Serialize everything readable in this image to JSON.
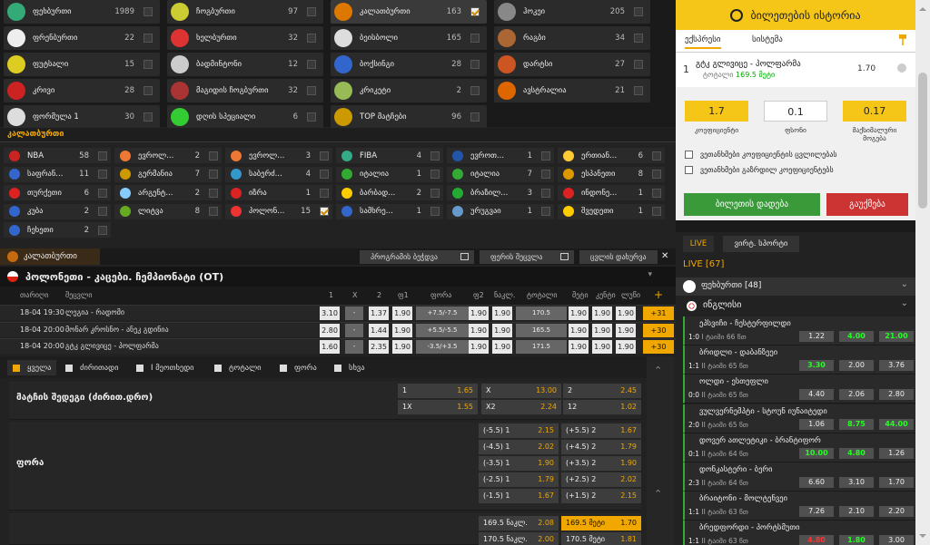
{
  "sports": [
    {
      "name": "ფეხბურთი",
      "count": "1989",
      "color": "#3a7",
      "checked": false
    },
    {
      "name": "ჩოგბურთი",
      "count": "97",
      "color": "#cc3",
      "checked": false
    },
    {
      "name": "კალათბურთი",
      "count": "163",
      "color": "#d70",
      "checked": true,
      "selected": true
    },
    {
      "name": "ჰოკეი",
      "count": "205",
      "color": "#888",
      "checked": false
    },
    {
      "name": "ფრენბურთი",
      "count": "22",
      "color": "#eee",
      "checked": false
    },
    {
      "name": "ხელბურთი",
      "count": "32",
      "color": "#d33",
      "checked": false
    },
    {
      "name": "ბეისბოლი",
      "count": "165",
      "color": "#ddd",
      "checked": false
    },
    {
      "name": "რაგბი",
      "count": "34",
      "color": "#a63",
      "checked": false
    },
    {
      "name": "ფუტსალი",
      "count": "15",
      "color": "#dc2",
      "checked": false
    },
    {
      "name": "ბადმინტონი",
      "count": "12",
      "color": "#ccc",
      "checked": false
    },
    {
      "name": "ბოქსინგი",
      "count": "28",
      "color": "#36c",
      "checked": false
    },
    {
      "name": "დარტსი",
      "count": "27",
      "color": "#c52",
      "checked": false
    },
    {
      "name": "კრივი",
      "count": "28",
      "color": "#c22",
      "checked": false
    },
    {
      "name": "მაგიდის ჩოგბურთი",
      "count": "32",
      "color": "#a33",
      "checked": false
    },
    {
      "name": "კრიკეტი",
      "count": "2",
      "color": "#9b5",
      "checked": false
    },
    {
      "name": "ავსტრალია",
      "count": "21",
      "color": "#d60",
      "checked": false
    },
    {
      "name": "ფორმულა 1",
      "count": "30",
      "color": "#ddd",
      "checked": false
    },
    {
      "name": "დღის სპეციალი",
      "count": "6",
      "color": "#3c3",
      "checked": false
    },
    {
      "name": "TOP მატჩები",
      "count": "96",
      "color": "#c90",
      "checked": false
    }
  ],
  "categories_title": "კალათბურთი",
  "categories": [
    {
      "name": "NBA",
      "count": "58",
      "color": "#c22",
      "checked": false
    },
    {
      "name": "ევროლ...",
      "count": "2",
      "color": "#e73",
      "checked": false
    },
    {
      "name": "ევროლ...",
      "count": "3",
      "color": "#e73",
      "checked": false
    },
    {
      "name": "FIBA",
      "count": "4",
      "color": "#3a8",
      "checked": false
    },
    {
      "name": "ევროთ...",
      "count": "1",
      "color": "#25a",
      "checked": false
    },
    {
      "name": "ერთიან...",
      "count": "6",
      "color": "#fc3",
      "checked": false
    },
    {
      "name": "საფრან...",
      "count": "11",
      "color": "#36c",
      "checked": false
    },
    {
      "name": "გერმანია",
      "count": "7",
      "color": "#c90",
      "checked": false
    },
    {
      "name": "საბერძ...",
      "count": "4",
      "color": "#39c",
      "checked": false
    },
    {
      "name": "იტალია",
      "count": "1",
      "color": "#3a3",
      "checked": false
    },
    {
      "name": "იტალია",
      "count": "7",
      "color": "#3a3",
      "checked": false
    },
    {
      "name": "ესპანეთი",
      "count": "8",
      "color": "#d90",
      "checked": false
    },
    {
      "name": "თურქეთი",
      "count": "6",
      "color": "#d22",
      "checked": false
    },
    {
      "name": "არგენტ...",
      "count": "2",
      "color": "#8cf",
      "checked": false
    },
    {
      "name": "იზრა",
      "count": "1",
      "color": "#d22",
      "checked": false
    },
    {
      "name": "ბარბად...",
      "count": "2",
      "color": "#fc0",
      "checked": false
    },
    {
      "name": "ბრაზილ...",
      "count": "3",
      "color": "#2a3",
      "checked": false
    },
    {
      "name": "ინდონე...",
      "count": "1",
      "color": "#d22",
      "checked": false
    },
    {
      "name": "კუბა",
      "count": "2",
      "color": "#36c",
      "checked": false
    },
    {
      "name": "ლიტვა",
      "count": "8",
      "color": "#6a2",
      "checked": false
    },
    {
      "name": "პოლონ...",
      "count": "15",
      "color": "#e33",
      "checked": true
    },
    {
      "name": "სამხრე...",
      "count": "1",
      "color": "#36c",
      "checked": false
    },
    {
      "name": "ურუგვაი",
      "count": "1",
      "color": "#69c",
      "checked": false
    },
    {
      "name": "შვედეთი",
      "count": "1",
      "color": "#fc0",
      "checked": false
    },
    {
      "name": "ჩეხეთი",
      "count": "2",
      "color": "#36c",
      "checked": false
    }
  ],
  "toolbar": {
    "title": "კალათბურთი",
    "program": "პროგრამის ბეჭდვა",
    "search": "ფერის შეცვლა",
    "close": "ცვლის დახურვა",
    "close_x": "✕"
  },
  "match_header": "პოლონეთი - კაცები. ჩემპიონატი (OT)",
  "columns": {
    "date": "თარიღი",
    "match": "შეცვლი",
    "c1": "1",
    "cx": "X",
    "c2": "2",
    "f1": "ფ1",
    "fora": "ფორა",
    "f2": "ფ2",
    "kef": "ნაკლ.",
    "total": "ტოტალი",
    "more": "მეტი",
    "kripi": "კენტი",
    "luwi": "ლუწი",
    "plus": "+"
  },
  "rows": [
    {
      "date": "18-04 19:30",
      "match": "ლეგია - რადომი",
      "o1": "3.10",
      "ox": "-",
      "o2": "1.37",
      "f1": "1.90",
      "fora": "+7.5/-7.5",
      "f2": "1.90",
      "kef": "1.90",
      "total": "170.5",
      "more": "1.90",
      "odd": "1.90",
      "even": "1.90",
      "plus": "+31"
    },
    {
      "date": "18-04 20:00",
      "match": "მონარ კროსნო - ანეკ გდინია",
      "o1": "2.80",
      "ox": "-",
      "o2": "1.44",
      "f1": "1.90",
      "fora": "+5.5/-5.5",
      "f2": "1.90",
      "kef": "1.90",
      "total": "165.5",
      "more": "1.90",
      "odd": "1.90",
      "even": "1.90",
      "plus": "+30"
    },
    {
      "date": "18-04 20:00",
      "match": "გტკ გლივიცე - პოლფარმა",
      "o1": "1.60",
      "ox": "-",
      "o2": "2.35",
      "f1": "1.90",
      "fora": "-3.5/+3.5",
      "f2": "1.90",
      "kef": "1.90",
      "total": "171.5",
      "more": "1.90",
      "odd": "1.90",
      "even": "1.90",
      "plus": "+30"
    }
  ],
  "tabs": [
    "ყველა",
    "ძირითადი",
    "I მეოთხედი",
    "ტოტალი",
    "ფორა",
    "სხვა"
  ],
  "markets": {
    "result_label": "მატჩის შედეგი (ძირით.დრო)",
    "result": [
      [
        "1",
        "1.65"
      ],
      [
        "X",
        "13.00"
      ],
      [
        "2",
        "2.45"
      ],
      [
        "1X",
        "1.55"
      ],
      [
        "X2",
        "2.24"
      ],
      [
        "12",
        "1.02"
      ]
    ],
    "fora_label": "ფორა",
    "fora": [
      [
        "(-5.5) 1",
        "2.15",
        "(+5.5) 2",
        "1.67"
      ],
      [
        "(-4.5) 1",
        "2.02",
        "(+4.5) 2",
        "1.79"
      ],
      [
        "(-3.5) 1",
        "1.90",
        "(+3.5) 2",
        "1.90"
      ],
      [
        "(-2.5) 1",
        "1.79",
        "(+2.5) 2",
        "2.02"
      ],
      [
        "(-1.5) 1",
        "1.67",
        "(+1.5) 2",
        "2.15"
      ]
    ],
    "totals": [
      [
        "169.5 ნაკლ.",
        "2.08",
        "169.5 მეტი",
        "1.70"
      ],
      [
        "170.5 ნაკლ.",
        "2.00",
        "170.5 მეტი",
        "1.81"
      ]
    ]
  },
  "slip": {
    "history": "ბილეთების ისტორია",
    "tab_single": "ექსპრესი",
    "tab_system": "სისტემა",
    "bet_no": "1",
    "bet_title": "გტკ გლივიცე - პოლფარმა",
    "bet_type": "ტოტალი",
    "bet_value": "169.5 მეტი",
    "bet_odd": "1.70",
    "coef": "1.7",
    "stake": "0.1",
    "win": "0.17",
    "coef_lbl": "კოეფიციენტი",
    "stake_lbl": "ფსონი",
    "win_lbl": "მაქსიმალური მოგება",
    "chk1": "ვეთანხმები კოეფიციენტის ცვლილებას",
    "chk2": "ვეთანხმები გაზრდილ კოეფიციენტებს",
    "place": "ბილეთის დადება",
    "cancel": "გაუქმება"
  },
  "live": {
    "tab_live": "LIVE",
    "tab_other": "ვირტ. სპორტი",
    "header": "LIVE [67]",
    "sport": "ფეხბურთი [48]",
    "league": "ინგლისი",
    "events": [
      {
        "title": "ეპსვიჩი - ჩესტერფილდი",
        "score": "1:0",
        "period": "I",
        "time": "ტაიმი 66 წთ",
        "o": [
          "1.22",
          "4.00",
          "21.00"
        ],
        "c": [
          "",
          "gr",
          "gr"
        ]
      },
      {
        "title": "ბრიდლი - დაბანზეეი",
        "score": "1:1",
        "period": "II",
        "time": "ტაიმი 65 წთ",
        "o": [
          "3.30",
          "2.00",
          "3.76"
        ],
        "c": [
          "gr",
          "",
          ""
        ]
      },
      {
        "title": "ოლდი - ესთეფლი",
        "score": "0:0",
        "period": "II",
        "time": "ტაიმი 65 წთ",
        "o": [
          "4.40",
          "2.06",
          "2.80"
        ],
        "c": [
          "",
          "",
          ""
        ]
      },
      {
        "title": "ვულვერნემპტი - სტოუნ იუნაიტედი",
        "score": "2:0",
        "period": "II",
        "time": "ტაიმი 65 წთ",
        "o": [
          "1.06",
          "8.75",
          "44.00"
        ],
        "c": [
          "",
          "gr",
          "gr"
        ]
      },
      {
        "title": "დოვერ ათლეტიკი - ბრანტიფორ",
        "score": "0:1",
        "period": "II",
        "time": "ტაიმი 64 წთ",
        "o": [
          "10.00",
          "4.80",
          "1.26"
        ],
        "c": [
          "gr",
          "gr",
          ""
        ]
      },
      {
        "title": "დონკასტერი - ბერი",
        "score": "2:3",
        "period": "II",
        "time": "ტაიმი 64 წთ",
        "o": [
          "6.60",
          "3.10",
          "1.70"
        ],
        "c": [
          "",
          "",
          ""
        ]
      },
      {
        "title": "ბრაიტონი - მოლტენვეი",
        "score": "1:1",
        "period": "II",
        "time": "ტაიმი 63 წთ",
        "o": [
          "7.26",
          "2.10",
          "2.20"
        ],
        "c": [
          "",
          "",
          ""
        ]
      },
      {
        "title": "ბრედფორდი - პორტსმუთი",
        "score": "1:1",
        "period": "II",
        "time": "ტაიმი 63 წთ",
        "o": [
          "4.80",
          "1.80",
          "3.00"
        ],
        "c": [
          "rd",
          "gr",
          ""
        ]
      }
    ]
  }
}
